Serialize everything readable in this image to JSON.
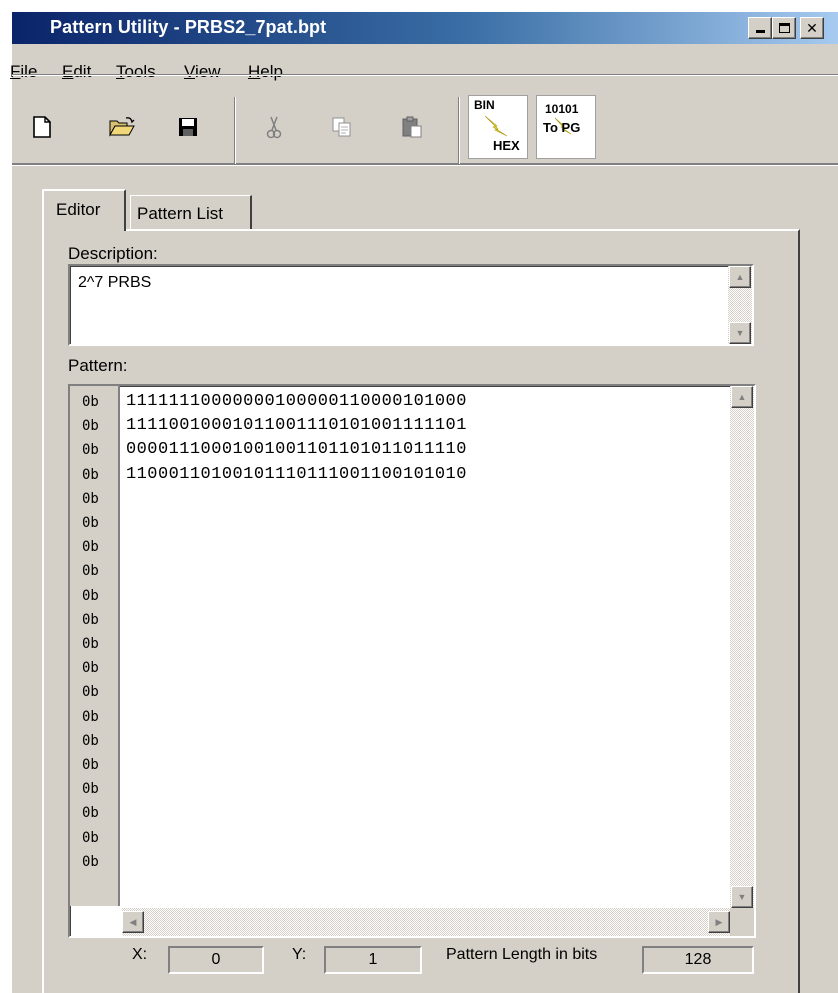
{
  "window": {
    "title": "Pattern Utility - PRBS2_7pat.bpt"
  },
  "menu": [
    "File",
    "Edit",
    "Tools",
    "View",
    "Help"
  ],
  "toolbar": {
    "bin_hex_top": "BIN",
    "bin_hex_bottom": "HEX",
    "to_pg_top": "10101",
    "to_pg_bottom": "To PG"
  },
  "tabs": {
    "editor": "Editor",
    "pattern_list": "Pattern List"
  },
  "editor": {
    "description_label": "Description:",
    "description_value": "2^7 PRBS",
    "pattern_label": "Pattern:",
    "row_prefix": "0b",
    "row_count": 20,
    "pattern_lines": [
      "11111110000000100000110000101000",
      "11110010001011001110101001111101",
      "00001110001001001101101011011110",
      "11000110100101110111001100101010"
    ]
  },
  "status": {
    "x_label": "X:",
    "x_value": "0",
    "y_label": "Y:",
    "y_value": "1",
    "length_label": "Pattern Length in bits",
    "length_value": "128"
  },
  "colors": {
    "title_gradient_start": "#0a246a",
    "title_gradient_end": "#a6caf0",
    "face": "#d4d0c8"
  }
}
